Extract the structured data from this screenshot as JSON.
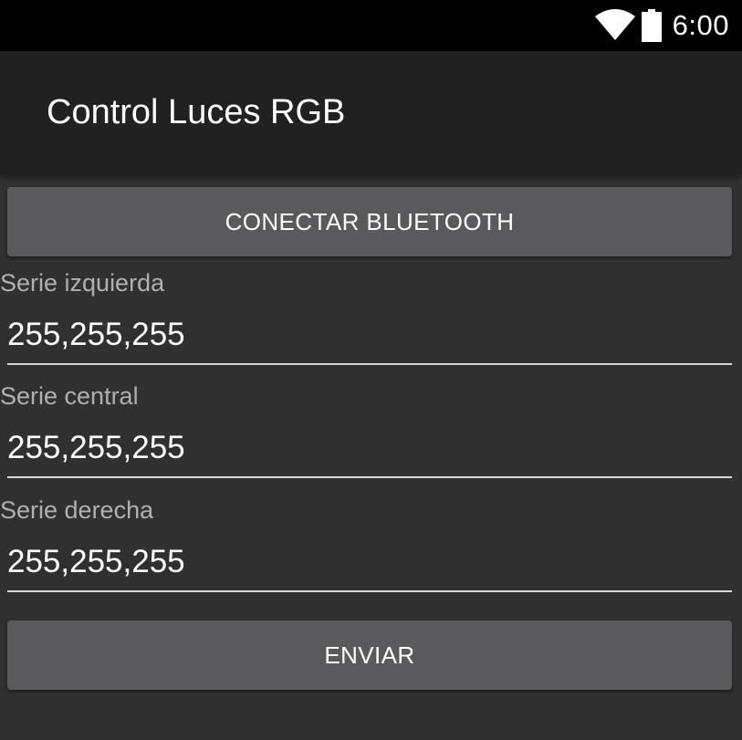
{
  "status_bar": {
    "time": "6:00",
    "icons": [
      "wifi-icon",
      "battery-icon"
    ]
  },
  "app_bar": {
    "title": "Control Luces RGB"
  },
  "buttons": {
    "connect_label": "CONECTAR BLUETOOTH",
    "send_label": "ENVIAR"
  },
  "fields": [
    {
      "label": "Serie izquierda",
      "value": "255,255,255"
    },
    {
      "label": "Serie central",
      "value": "255,255,255"
    },
    {
      "label": "Serie derecha",
      "value": "255,255,255"
    }
  ],
  "colors": {
    "background": "#303030",
    "app_bar": "#212121",
    "status_bar": "#000000",
    "button": "#5a5a5c",
    "label": "#b0b0b0",
    "text": "#ffffff"
  }
}
